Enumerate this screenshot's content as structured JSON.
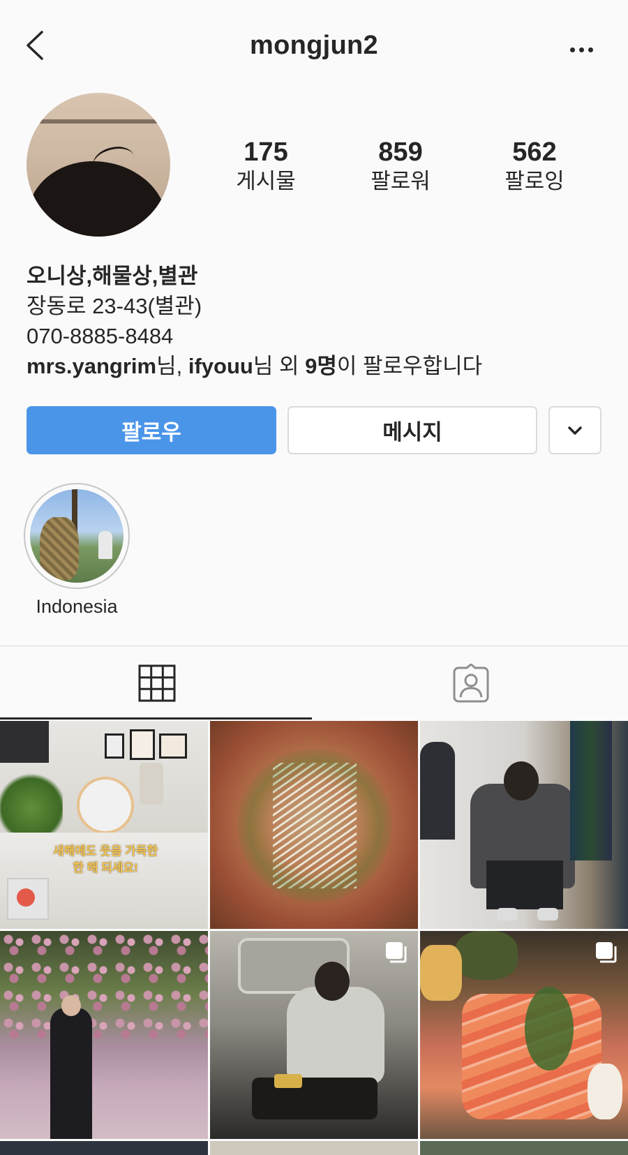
{
  "header": {
    "username": "mongjun2"
  },
  "stats": [
    {
      "value": "175",
      "label": "게시물"
    },
    {
      "value": "859",
      "label": "팔로워"
    },
    {
      "value": "562",
      "label": "팔로잉"
    }
  ],
  "bio": {
    "name": "오니상,해물상,별관",
    "address": "장동로 23-43(별관)",
    "phone": "070-8885-8484",
    "followed_by": {
      "user1": "mrs.yangrim",
      "sep1": "님, ",
      "user2": "ifyouu",
      "sep2": "님 외 ",
      "count": "9명",
      "suffix": "이 팔로우합니다"
    }
  },
  "actions": {
    "follow_label": "팔로우",
    "message_label": "메시지"
  },
  "highlights": [
    {
      "label": "Indonesia"
    }
  ],
  "tabs": [
    {
      "icon": "grid-icon",
      "active": true
    },
    {
      "icon": "tagged-icon",
      "active": false
    }
  ],
  "posts": [
    {
      "overlay_text_1": "새해에도 웃음 가득한",
      "overlay_text_2": "한 해 되세요!",
      "multi": false
    },
    {
      "multi": false
    },
    {
      "multi": false
    },
    {
      "multi": false
    },
    {
      "multi": true
    },
    {
      "multi": true
    }
  ],
  "colors": {
    "follow_button": "#4b95e9",
    "text": "#262626",
    "border": "#dbdbdb",
    "background": "#fafafa"
  }
}
